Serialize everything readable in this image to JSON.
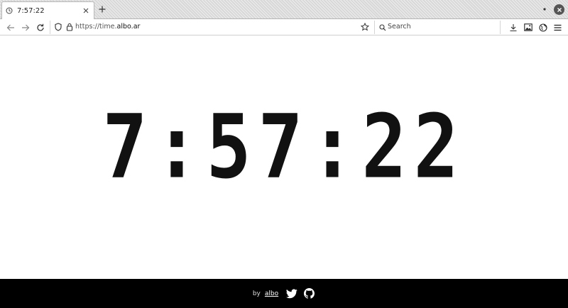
{
  "tab": {
    "title": "7:57:22"
  },
  "toolbar": {
    "url_prefix": "https://time.",
    "url_host": "albo.ar",
    "search_placeholder": "Search"
  },
  "clock": {
    "time": "7:57:22"
  },
  "footer": {
    "by": "by",
    "author": "albo"
  },
  "colors": {
    "footer_bg": "#000000",
    "clock": "#111111"
  }
}
